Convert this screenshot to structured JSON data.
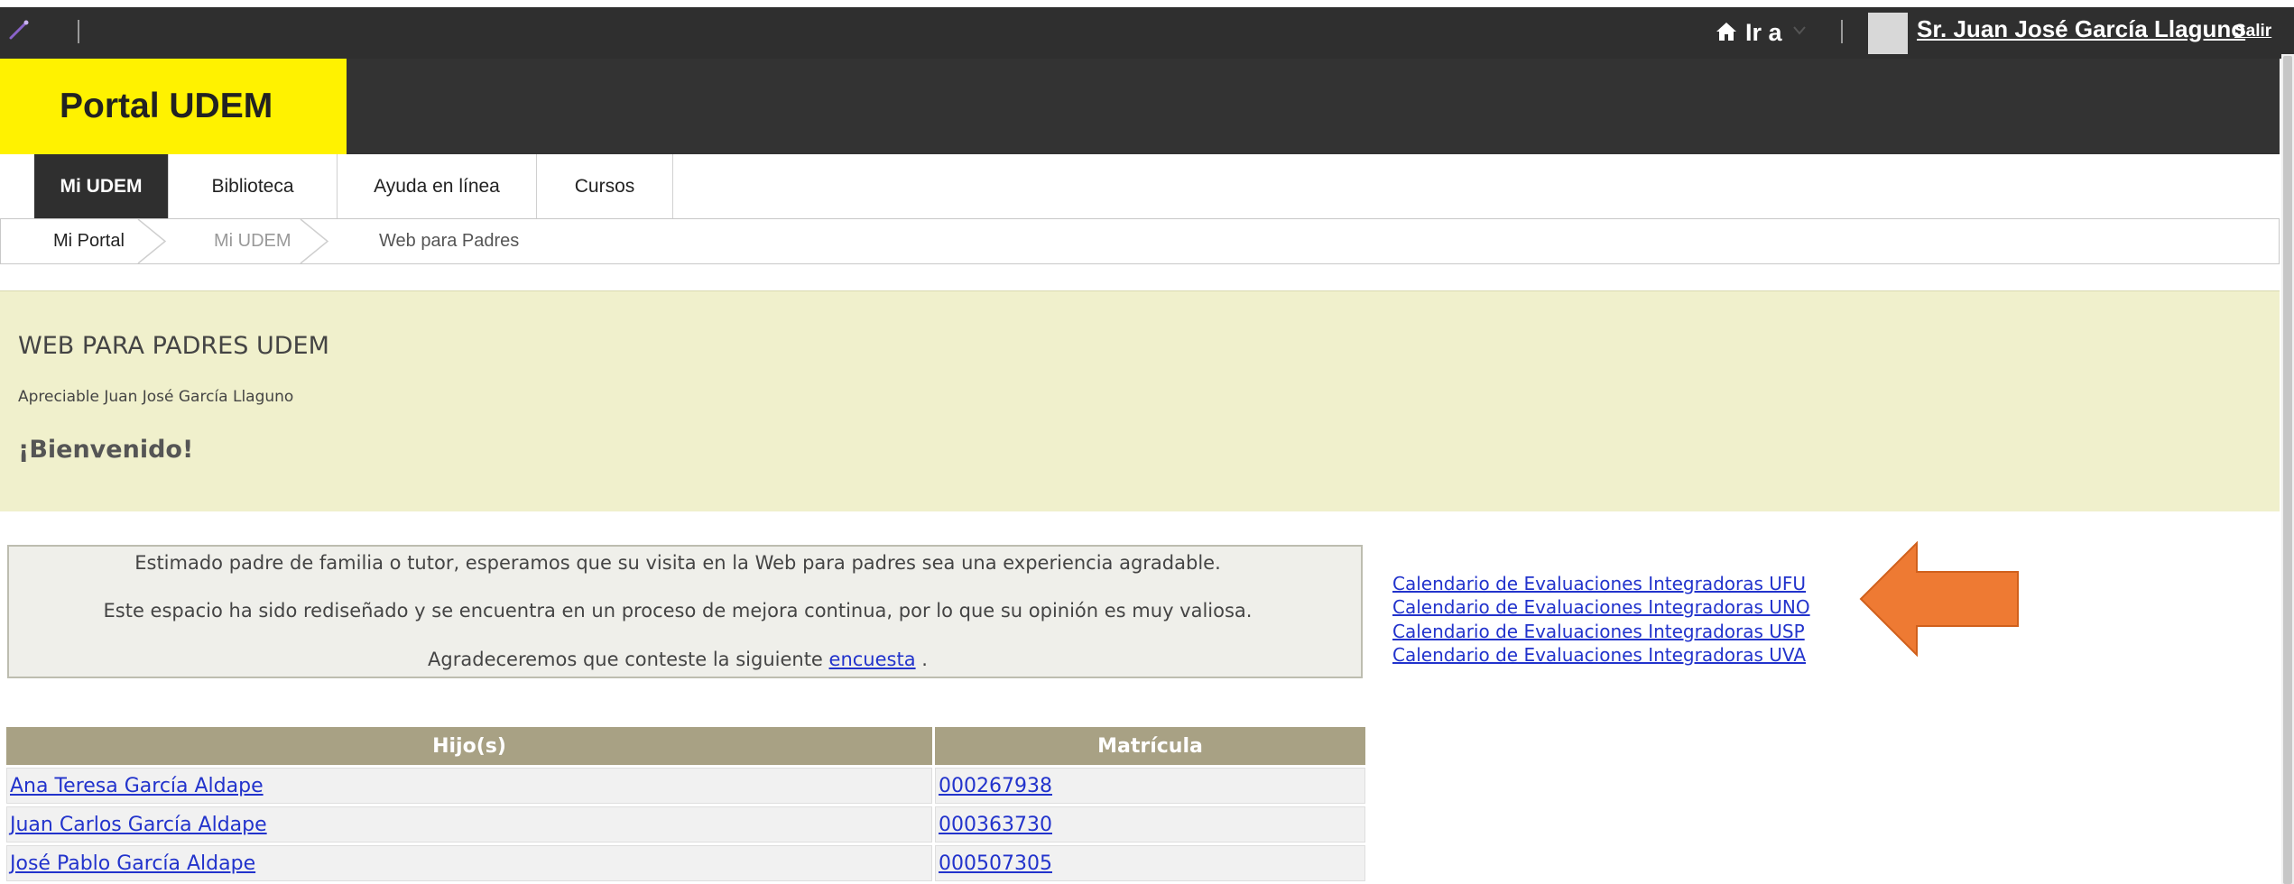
{
  "topbar": {
    "goto_label": "Ir a",
    "user_name": "Sr. Juan José García Llaguno",
    "logout_label": "Salir"
  },
  "header": {
    "logo_text": "Portal UDEM"
  },
  "nav": {
    "items": [
      "Mi UDEM",
      "Biblioteca",
      "Ayuda en línea",
      "Cursos"
    ],
    "active": "Mi UDEM"
  },
  "breadcrumb": [
    "Mi Portal",
    "Mi UDEM",
    "Web para Padres"
  ],
  "welcome": {
    "title": "WEB PARA PADRES UDEM",
    "greeting": "Apreciable Juan José García Llaguno",
    "welcome": "¡Bienvenido!"
  },
  "notice": {
    "line1": "Estimado padre de familia o tutor, esperamos que su visita en la Web para padres sea una experiencia agradable.",
    "line2": "Este espacio ha sido rediseñado y se encuentra en un proceso de mejora continua, por lo que su opinión es muy valiosa.",
    "line3_prefix": "Agradeceremos que conteste la siguiente ",
    "survey_link": "encuesta",
    "line3_suffix": " ."
  },
  "calendar_links": [
    "Calendario de Evaluaciones Integradoras UFU",
    "Calendario de Evaluaciones Integradoras UNO",
    "Calendario de Evaluaciones Integradoras USP",
    "Calendario de Evaluaciones Integradoras UVA"
  ],
  "children_table": {
    "headers": [
      "Hijo(s)",
      "Matrícula"
    ],
    "rows": [
      {
        "name": "Ana Teresa García Aldape",
        "id": "000267938"
      },
      {
        "name": "Juan Carlos García Aldape",
        "id": "000363730"
      },
      {
        "name": "José Pablo García Aldape",
        "id": "000507305"
      }
    ]
  },
  "colors": {
    "topbar": "#2f2f2f",
    "logo_bg": "#fff200",
    "welcome_bg": "#f0f0cc",
    "table_header": "#a8a184",
    "link": "#2233cc",
    "arrow": "#ee7a33"
  },
  "icons": [
    "magic-wand-icon",
    "home-icon",
    "caret-down-icon",
    "avatar",
    "chevron-right-icon",
    "left-arrow-annotation"
  ]
}
